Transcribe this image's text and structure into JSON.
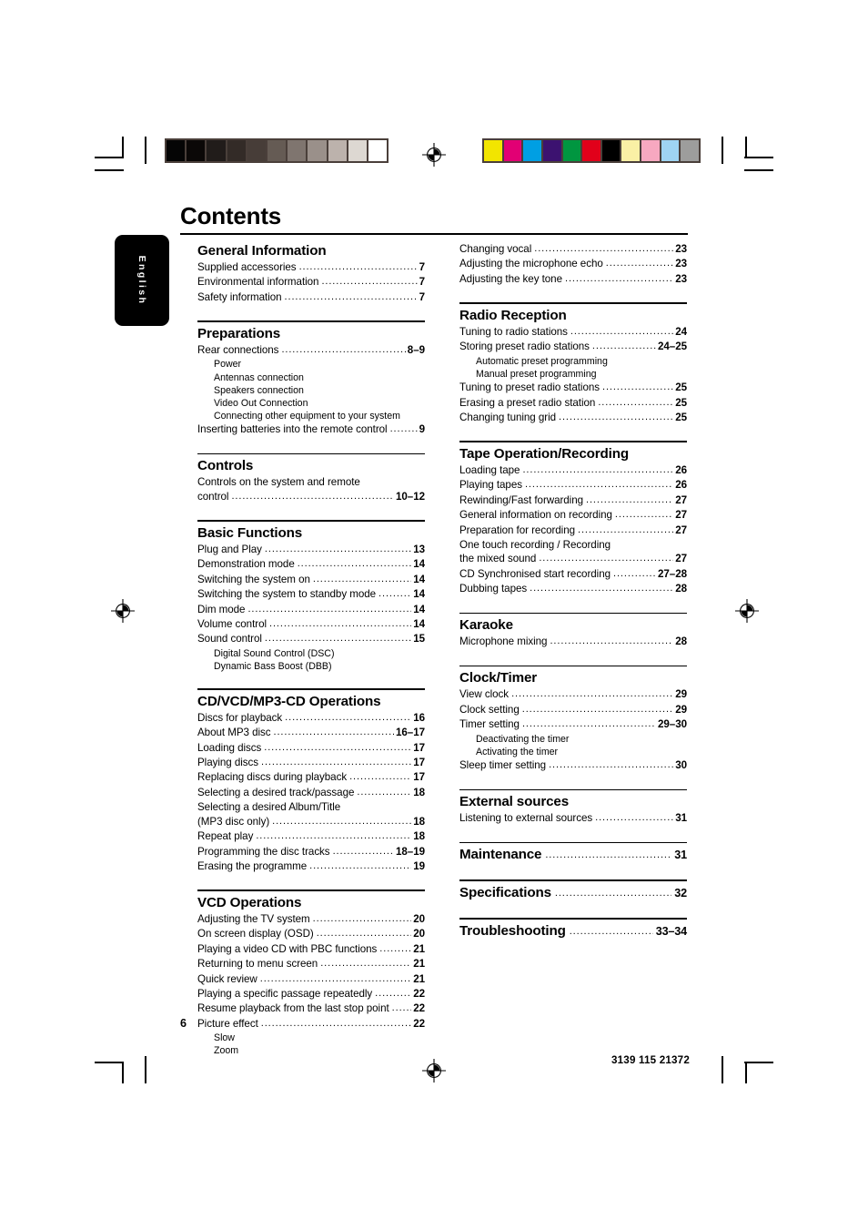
{
  "page": {
    "title": "Contents",
    "language_tab": "English",
    "page_number": "6",
    "footer_code": "3139 115 21372",
    "leader": "........................................................................................................................"
  },
  "marks": {
    "grayscale_swatches": [
      "#050505",
      "#0b0807",
      "#211c1a",
      "#332b27",
      "#473d38",
      "#655b54",
      "#7f756f",
      "#9a908a",
      "#bcb2ac",
      "#ddd8d2",
      "#ffffff"
    ],
    "color_swatches": [
      "#f2e500",
      "#e20074",
      "#009fe3",
      "#3c1270",
      "#009640",
      "#e1001a",
      "#000000",
      "#faf0a5",
      "#f7a8c0",
      "#9fd4f2",
      "#9d9d9c"
    ],
    "mark_color": "#000000",
    "strip_frame_color": "#4a3f3a"
  },
  "columns": {
    "left": [
      {
        "heading": "General Information",
        "entries": [
          {
            "text": "Supplied accessories",
            "page": "7"
          },
          {
            "text": "Environmental information",
            "page": "7"
          },
          {
            "text": "Safety information",
            "page": "7"
          }
        ]
      },
      {
        "heading": "Preparations",
        "entries": [
          {
            "text": "Rear connections",
            "page": "8–9"
          },
          {
            "sub": "Power"
          },
          {
            "sub": "Antennas connection"
          },
          {
            "sub": "Speakers connection"
          },
          {
            "sub": "Video Out Connection"
          },
          {
            "sub": "Connecting other equipment to your system"
          },
          {
            "text": "Inserting batteries into the remote control",
            "page": "9"
          }
        ]
      },
      {
        "heading": "Controls",
        "entries": [
          {
            "text": "Controls on the system and remote",
            "cont": true
          },
          {
            "text": "control",
            "page": "10–12"
          }
        ]
      },
      {
        "heading": "Basic Functions",
        "entries": [
          {
            "text": "Plug and Play",
            "page": "13"
          },
          {
            "text": "Demonstration mode",
            "page": "14"
          },
          {
            "text": "Switching the system on",
            "page": "14"
          },
          {
            "text": "Switching the system to standby mode",
            "page": "14"
          },
          {
            "text": "Dim mode",
            "page": "14"
          },
          {
            "text": "Volume control",
            "page": "14"
          },
          {
            "text": "Sound control",
            "page": "15"
          },
          {
            "sub": "Digital Sound Control (DSC)"
          },
          {
            "sub": "Dynamic Bass Boost (DBB)"
          }
        ]
      },
      {
        "heading": "CD/VCD/MP3-CD Operations",
        "entries": [
          {
            "text": "Discs for playback",
            "page": "16"
          },
          {
            "text": "About MP3 disc",
            "page": "16–17"
          },
          {
            "text": "Loading discs",
            "page": "17"
          },
          {
            "text": "Playing discs",
            "page": "17"
          },
          {
            "text": "Replacing discs during playback",
            "page": "17"
          },
          {
            "text": "Selecting a desired track/passage",
            "page": "18"
          },
          {
            "text": "Selecting a desired Album/Title",
            "cont": true
          },
          {
            "text": "(MP3 disc only)",
            "page": "18"
          },
          {
            "text": "Repeat play",
            "page": "18"
          },
          {
            "text": "Programming the disc tracks",
            "page": "18–19"
          },
          {
            "text": "Erasing the programme",
            "page": "19"
          }
        ]
      },
      {
        "heading": "VCD Operations",
        "entries": [
          {
            "text": "Adjusting the TV system",
            "page": "20"
          },
          {
            "text": "On screen display (OSD)",
            "page": "20"
          },
          {
            "text": "Playing a video CD with PBC functions",
            "page": "21"
          },
          {
            "text": "Returning to menu screen",
            "page": "21"
          },
          {
            "text": "Quick review",
            "page": "21"
          },
          {
            "text": "Playing a specific passage repeatedly",
            "page": "22"
          },
          {
            "text": "Resume playback from the last stop point",
            "page": "22"
          },
          {
            "text": "Picture effect",
            "page": "22"
          },
          {
            "sub": "Slow"
          },
          {
            "sub": "Zoom"
          }
        ]
      }
    ],
    "right": [
      {
        "heading": null,
        "entries": [
          {
            "text": "Changing vocal",
            "page": "23"
          },
          {
            "text": "Adjusting the microphone echo",
            "page": "23"
          },
          {
            "text": "Adjusting the key tone",
            "page": "23"
          }
        ]
      },
      {
        "heading": "Radio Reception",
        "entries": [
          {
            "text": "Tuning to radio stations",
            "page": "24"
          },
          {
            "text": "Storing preset radio stations",
            "page": "24–25"
          },
          {
            "sub": "Automatic preset programming"
          },
          {
            "sub": "Manual preset programming"
          },
          {
            "text": "Tuning to preset radio stations",
            "page": "25"
          },
          {
            "text": "Erasing a preset radio station",
            "page": "25"
          },
          {
            "text": "Changing tuning grid",
            "page": "25"
          }
        ]
      },
      {
        "heading": "Tape Operation/Recording",
        "entries": [
          {
            "text": "Loading tape",
            "page": "26"
          },
          {
            "text": "Playing tapes",
            "page": "26"
          },
          {
            "text": "Rewinding/Fast forwarding",
            "page": "27"
          },
          {
            "text": "General information on recording",
            "page": "27"
          },
          {
            "text": "Preparation for recording",
            "page": "27"
          },
          {
            "text": "One touch recording / Recording",
            "cont": true
          },
          {
            "text": "the mixed sound",
            "page": "27"
          },
          {
            "text": "CD Synchronised start recording",
            "page": "27–28"
          },
          {
            "text": "Dubbing tapes",
            "page": "28"
          }
        ]
      },
      {
        "heading": "Karaoke",
        "entries": [
          {
            "text": "Microphone mixing",
            "page": "28"
          }
        ]
      },
      {
        "heading": "Clock/Timer",
        "entries": [
          {
            "text": "View clock",
            "page": "29"
          },
          {
            "text": "Clock setting",
            "page": "29"
          },
          {
            "text": "Timer setting",
            "page": "29–30"
          },
          {
            "sub": "Deactivating the timer"
          },
          {
            "sub": "Activating the timer"
          },
          {
            "text": "Sleep timer setting",
            "page": "30"
          }
        ]
      },
      {
        "heading": "External sources",
        "entries": [
          {
            "text": "Listening to external sources",
            "page": "31"
          }
        ]
      },
      {
        "heading": "Maintenance",
        "heading_page": "31",
        "entries": []
      },
      {
        "heading": "Specifications",
        "heading_page": "32",
        "entries": []
      },
      {
        "heading": "Troubleshooting",
        "heading_page": "33–34",
        "entries": []
      }
    ]
  }
}
